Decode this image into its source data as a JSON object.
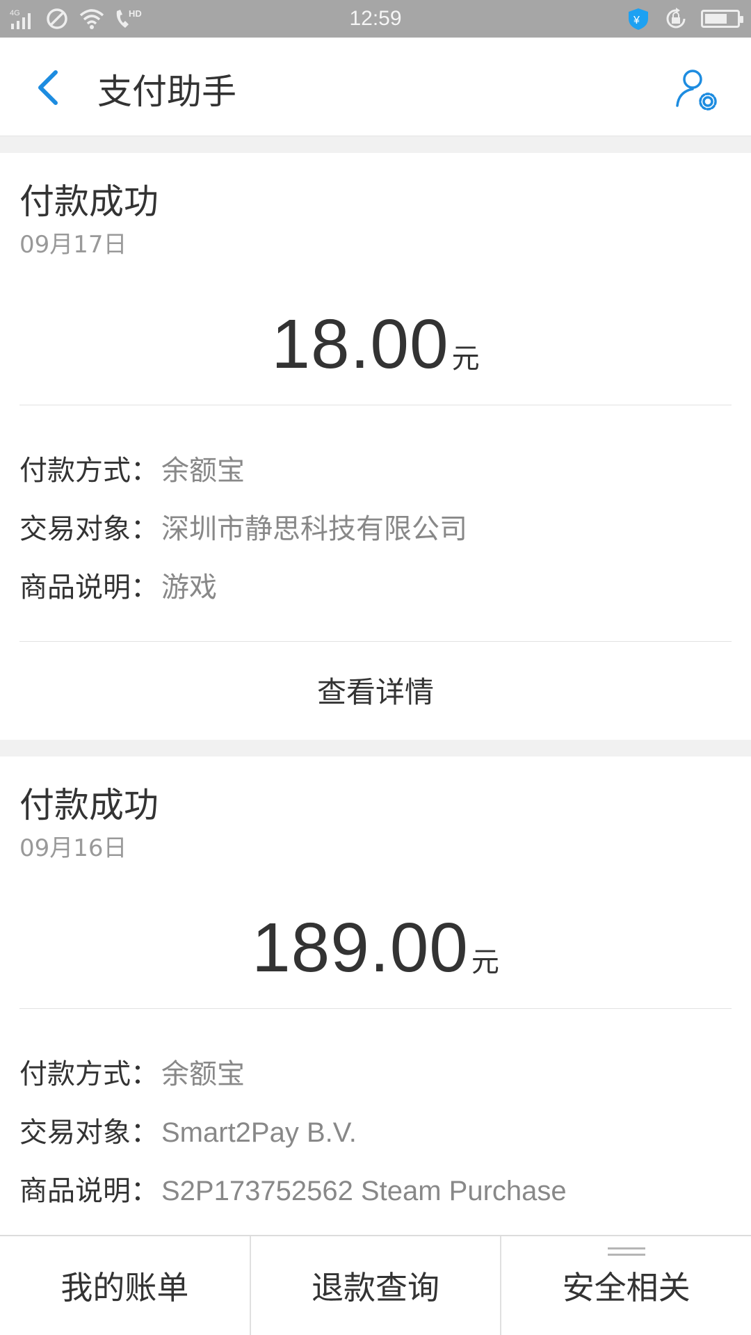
{
  "status_bar": {
    "time": "12:59",
    "network": "4G",
    "hd_label": "HD",
    "icons": [
      "signal-icon",
      "do-not-disturb-icon",
      "wifi-icon",
      "hd-call-icon",
      "shield-yen-icon",
      "rotation-lock-icon",
      "battery-icon"
    ]
  },
  "header": {
    "title": "支付助手",
    "back_icon": "chevron-left-icon",
    "settings_icon": "user-settings-icon",
    "accent_color": "#1d8ce0"
  },
  "transactions": [
    {
      "status": "付款成功",
      "date": "09月17日",
      "amount": "18.00",
      "unit": "元",
      "fields": [
        {
          "label": "付款方式：",
          "value": "余额宝"
        },
        {
          "label": "交易对象：",
          "value": "深圳市静思科技有限公司"
        },
        {
          "label": "商品说明：",
          "value": "游戏"
        }
      ],
      "detail_label": "查看详情"
    },
    {
      "status": "付款成功",
      "date": "09月16日",
      "amount": "189.00",
      "unit": "元",
      "fields": [
        {
          "label": "付款方式：",
          "value": "余额宝"
        },
        {
          "label": "交易对象：",
          "value": "Smart2Pay B.V."
        },
        {
          "label": "商品说明：",
          "value": "S2P173752562 Steam Purchase"
        }
      ]
    }
  ],
  "tabbar": {
    "tabs": [
      {
        "label": "我的账单"
      },
      {
        "label": "退款查询"
      },
      {
        "label": "安全相关",
        "icon": "menu-icon"
      }
    ]
  }
}
